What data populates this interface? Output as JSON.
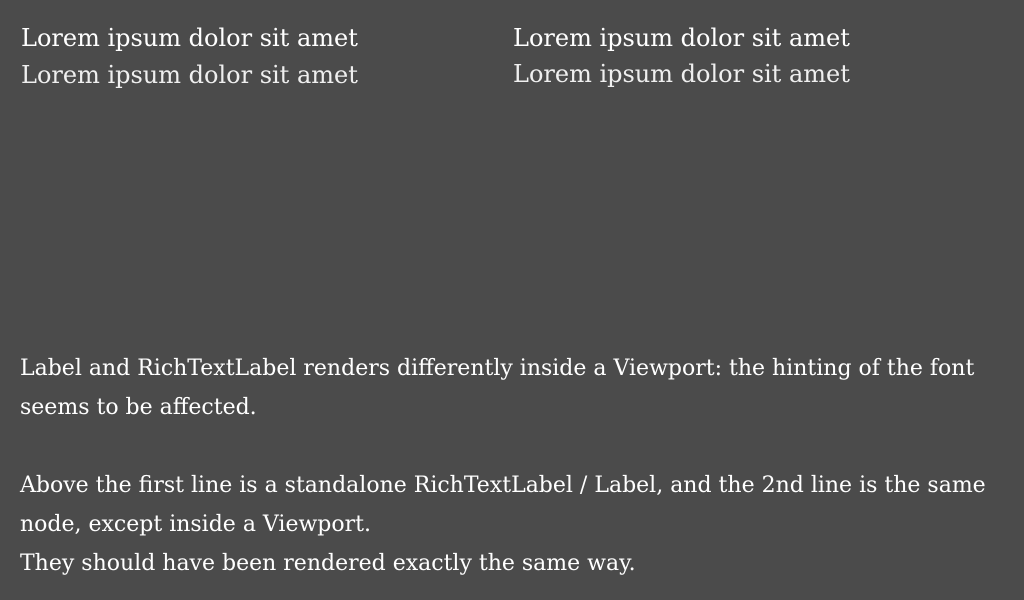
{
  "left": {
    "line1": "Lorem ipsum dolor sit amet",
    "line2": "Lorem ipsum dolor sit amet"
  },
  "right": {
    "line1": "Lorem ipsum dolor sit amet",
    "line2": "Lorem ipsum dolor sit amet"
  },
  "description": {
    "paragraph1": "Label and RichTextLabel renders differently inside a Viewport: the hinting of the font seems to be affected.",
    "paragraph2": "Above the first line is a standalone RichTextLabel / Label, and the 2nd line is the same node, except inside a Viewport.",
    "paragraph3": "They should have been rendered exactly the same way."
  },
  "colors": {
    "background": "#4b4b4b",
    "text": "#ffffff"
  }
}
